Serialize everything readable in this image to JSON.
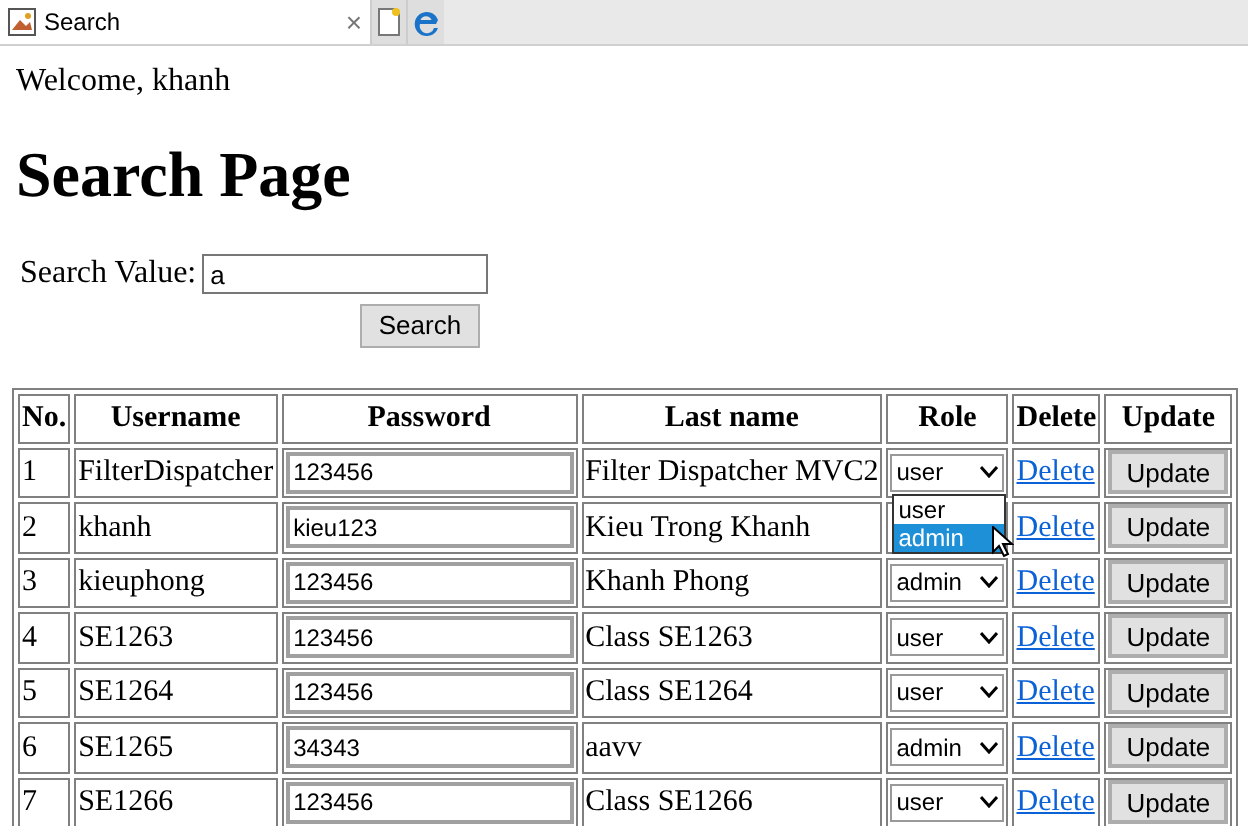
{
  "tab": {
    "title": "Search",
    "close": "×"
  },
  "welcome": "Welcome, khanh",
  "heading": "Search Page",
  "search": {
    "label": "Search Value:",
    "value": "a",
    "button": "Search"
  },
  "table": {
    "columns": [
      "No.",
      "Username",
      "Password",
      "Last name",
      "Role",
      "Delete",
      "Update"
    ],
    "rows": [
      {
        "no": "1",
        "username": "FilterDispatcher",
        "password": "123456",
        "last_name": "Filter Dispatcher MVC2",
        "role": "user",
        "delete": "Delete",
        "update": "Update",
        "role_menu": [
          {
            "label": "user",
            "selected": false
          },
          {
            "label": "admin",
            "selected": true
          }
        ]
      },
      {
        "no": "2",
        "username": "khanh",
        "password": "kieu123",
        "last_name": "Kieu Trong Khanh",
        "delete": "Delete",
        "update": "Update"
      },
      {
        "no": "3",
        "username": "kieuphong",
        "password": "123456",
        "last_name": "Khanh Phong",
        "role": "admin",
        "delete": "Delete",
        "update": "Update"
      },
      {
        "no": "4",
        "username": "SE1263",
        "password": "123456",
        "last_name": "Class SE1263",
        "role": "user",
        "delete": "Delete",
        "update": "Update"
      },
      {
        "no": "5",
        "username": "SE1264",
        "password": "123456",
        "last_name": "Class SE1264",
        "role": "user",
        "delete": "Delete",
        "update": "Update"
      },
      {
        "no": "6",
        "username": "SE1265",
        "password": "34343",
        "last_name": "aavv",
        "role": "admin",
        "delete": "Delete",
        "update": "Update"
      },
      {
        "no": "7",
        "username": "SE1266",
        "password": "123456",
        "last_name": "Class SE1266",
        "role": "user",
        "delete": "Delete",
        "update": "Update"
      }
    ]
  }
}
